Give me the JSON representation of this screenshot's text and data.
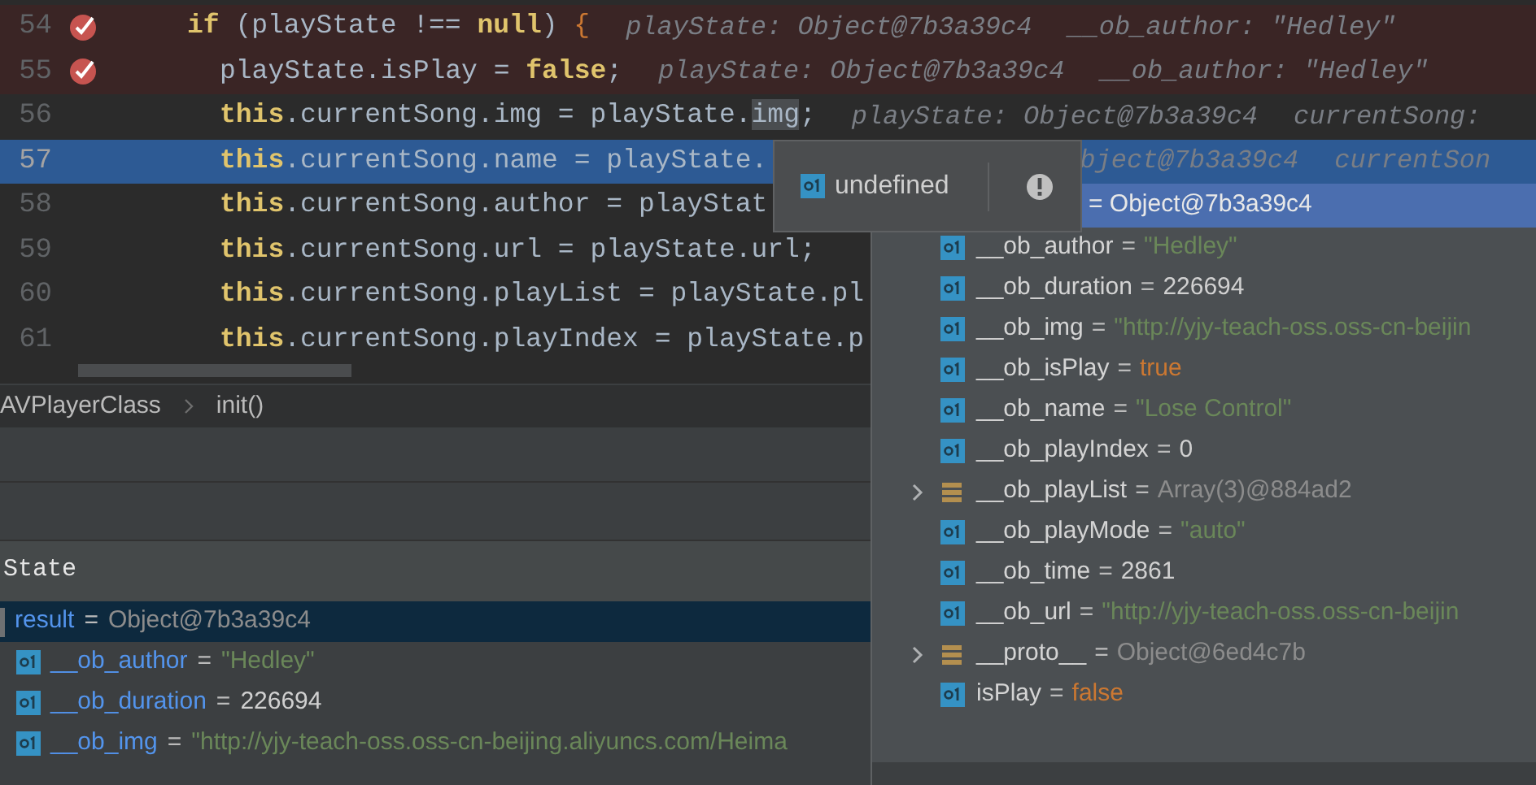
{
  "editor": {
    "lines": [
      {
        "number": "54",
        "breakpoint": true,
        "selected": false,
        "tokens": [
          {
            "text": "if",
            "kind": "keyword"
          },
          {
            "text": " (playState !== ",
            "kind": "plain"
          },
          {
            "text": "null",
            "kind": "keyword"
          },
          {
            "text": ") ",
            "kind": "plain"
          },
          {
            "text": "{",
            "kind": "brace"
          }
        ],
        "hints": [
          "playState: Object@7b3a39c4",
          "__ob_author: \"Hedley\""
        ],
        "children": [
          {
            "number": "55",
            "breakpoint": true,
            "selected": false,
            "tokens": [
              {
                "text": "playState.isPlay = ",
                "kind": "plain"
              },
              {
                "text": "false",
                "kind": "keyword"
              },
              {
                "text": ";",
                "kind": "plain"
              }
            ],
            "hints": [
              "playState: Object@7b3a39c4",
              "__ob_author: \"Hedley\""
            ]
          },
          {
            "number": "56",
            "breakpoint": false,
            "selected": false,
            "tokens": [
              {
                "text": "this",
                "kind": "keyword"
              },
              {
                "text": ".currentSong.img = playState.",
                "kind": "plain"
              },
              {
                "text": "img",
                "kind": "highlight"
              },
              {
                "text": ";",
                "kind": "plain"
              }
            ],
            "hints": [
              "playState: Object@7b3a39c4",
              "currentSong:"
            ]
          },
          {
            "number": "57",
            "breakpoint": false,
            "selected": true,
            "tokens": [
              {
                "text": "this",
                "kind": "keyword"
              },
              {
                "text": ".currentSong.name = playState.",
                "kind": "plain"
              }
            ],
            "hints": [
              "bject@7b3a39c4",
              "currentSon"
            ]
          },
          {
            "number": "58",
            "breakpoint": false,
            "selected": false,
            "tokens": [
              {
                "text": "this",
                "kind": "keyword"
              },
              {
                "text": ".currentSong.author = playStat",
                "kind": "plain"
              }
            ]
          },
          {
            "number": "59",
            "breakpoint": false,
            "selected": false,
            "tokens": [
              {
                "text": "this",
                "kind": "keyword"
              },
              {
                "text": ".currentSong.url = playState.url;",
                "kind": "plain"
              }
            ]
          },
          {
            "number": "60",
            "breakpoint": false,
            "selected": false,
            "tokens": [
              {
                "text": "this",
                "kind": "keyword"
              },
              {
                "text": ".currentSong.playList = playState.pl",
                "kind": "plain"
              }
            ]
          },
          {
            "number": "61",
            "breakpoint": false,
            "selected": false,
            "tokens": [
              {
                "text": "this",
                "kind": "keyword"
              },
              {
                "text": ".currentSong.playIndex = playState.p",
                "kind": "plain"
              }
            ]
          }
        ]
      }
    ]
  },
  "tooltip": {
    "value": "undefined"
  },
  "breadcrumb": [
    "AVPlayerClass",
    "init()"
  ],
  "variables_panel": {
    "title": "State",
    "rows": [
      {
        "kind": "root",
        "name": "result",
        "operator": "=",
        "value": {
          "kind": "object",
          "text": "Object@7b3a39c4"
        },
        "selected": true
      },
      {
        "kind": "primitive",
        "name": "__ob_author",
        "operator": "=",
        "value": {
          "kind": "string",
          "text": "\"Hedley\""
        },
        "selected": false
      },
      {
        "kind": "primitive",
        "name": "__ob_duration",
        "operator": "=",
        "value": {
          "kind": "number",
          "text": "226694"
        },
        "selected": false
      },
      {
        "kind": "primitive",
        "name": "__ob_img",
        "operator": "=",
        "value": {
          "kind": "string",
          "text": "\"http://yjy-teach-oss.oss-cn-beijing.aliyuncs.com/Heima"
        },
        "selected": false
      }
    ]
  },
  "popup": {
    "header": "= Object@7b3a39c4",
    "rows": [
      {
        "kind": "primitive",
        "name": "__ob_author",
        "operator": "=",
        "value": {
          "kind": "string",
          "text": "\"Hedley\""
        }
      },
      {
        "kind": "primitive",
        "name": "__ob_duration",
        "operator": "=",
        "value": {
          "kind": "number",
          "text": "226694"
        }
      },
      {
        "kind": "primitive",
        "name": "__ob_img",
        "operator": "=",
        "value": {
          "kind": "string",
          "text": "\"http://yjy-teach-oss.oss-cn-beijin"
        }
      },
      {
        "kind": "primitive",
        "name": "__ob_isPlay",
        "operator": "=",
        "value": {
          "kind": "boolean",
          "text": "true"
        }
      },
      {
        "kind": "primitive",
        "name": "__ob_name",
        "operator": "=",
        "value": {
          "kind": "string",
          "text": "\"Lose Control\""
        }
      },
      {
        "kind": "primitive",
        "name": "__ob_playIndex",
        "operator": "=",
        "value": {
          "kind": "number",
          "text": "0"
        }
      },
      {
        "kind": "object",
        "name": "__ob_playList",
        "operator": "=",
        "value": {
          "kind": "object",
          "text": "Array(3)@884ad2"
        }
      },
      {
        "kind": "primitive",
        "name": "__ob_playMode",
        "operator": "=",
        "value": {
          "kind": "string",
          "text": "\"auto\""
        }
      },
      {
        "kind": "primitive",
        "name": "__ob_time",
        "operator": "=",
        "value": {
          "kind": "number",
          "text": "2861"
        }
      },
      {
        "kind": "primitive",
        "name": "__ob_url",
        "operator": "=",
        "value": {
          "kind": "string",
          "text": "\"http://yjy-teach-oss.oss-cn-beijin"
        }
      },
      {
        "kind": "object",
        "name": "__proto__",
        "operator": "=",
        "value": {
          "kind": "object",
          "text": "Object@6ed4c7b"
        }
      },
      {
        "kind": "primitive",
        "name": "isPlay",
        "operator": "=",
        "value": {
          "kind": "boolean",
          "text": "false"
        }
      }
    ]
  }
}
